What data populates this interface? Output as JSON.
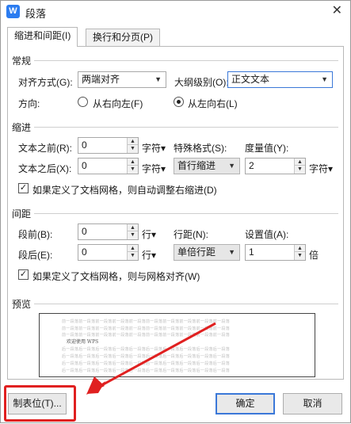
{
  "window": {
    "title": "段落",
    "close_glyph": "✕",
    "app_icon": "W"
  },
  "tabs": [
    {
      "label": "缩进和间距(I)",
      "active": true
    },
    {
      "label": "换行和分页(P)",
      "active": false
    }
  ],
  "general": {
    "heading": "常规",
    "alignment_label": "对齐方式(G):",
    "alignment_value": "两端对齐",
    "outline_label": "大纲级别(O):",
    "outline_value": "正文文本",
    "direction_label": "方向:",
    "rtl_label": "从右向左(F)",
    "ltr_label": "从左向右(L)"
  },
  "indent": {
    "heading": "缩进",
    "before_label": "文本之前(R):",
    "before_value": "0",
    "before_unit": "字符▾",
    "after_label": "文本之后(X):",
    "after_value": "0",
    "after_unit": "字符▾",
    "special_label": "特殊格式(S):",
    "special_value": "首行缩进",
    "measure_label": "度量值(Y):",
    "measure_value": "2",
    "measure_unit": "字符▾",
    "grid_check_label": "如果定义了文档网格，则自动调整右缩进(D)"
  },
  "spacing": {
    "heading": "间距",
    "before_label": "段前(B):",
    "before_value": "0",
    "before_unit": "行▾",
    "after_label": "段后(E):",
    "after_value": "0",
    "after_unit": "行▾",
    "line_label": "行距(N):",
    "line_value": "单倍行距",
    "setting_label": "设置值(A):",
    "setting_value": "1",
    "setting_unit": "倍",
    "grid_check_label": "如果定义了文档网格，则与网格对齐(W)"
  },
  "preview": {
    "heading": "预览",
    "prev_line": "前一段落前一段落前一段落前一段落前一段落前一段落前一段落前一段落前一段落前一段落",
    "sample": "欢迎使用 WPS",
    "next_line": "后一段落后一段落后一段落后一段落后一段落后一段落后一段落后一段落后一段落后一段落"
  },
  "footer": {
    "tabs_button": "制表位(T)...",
    "ok_button": "确定",
    "cancel_button": "取消"
  },
  "colors": {
    "annotation": "#e02020",
    "focus": "#3b78d8"
  }
}
